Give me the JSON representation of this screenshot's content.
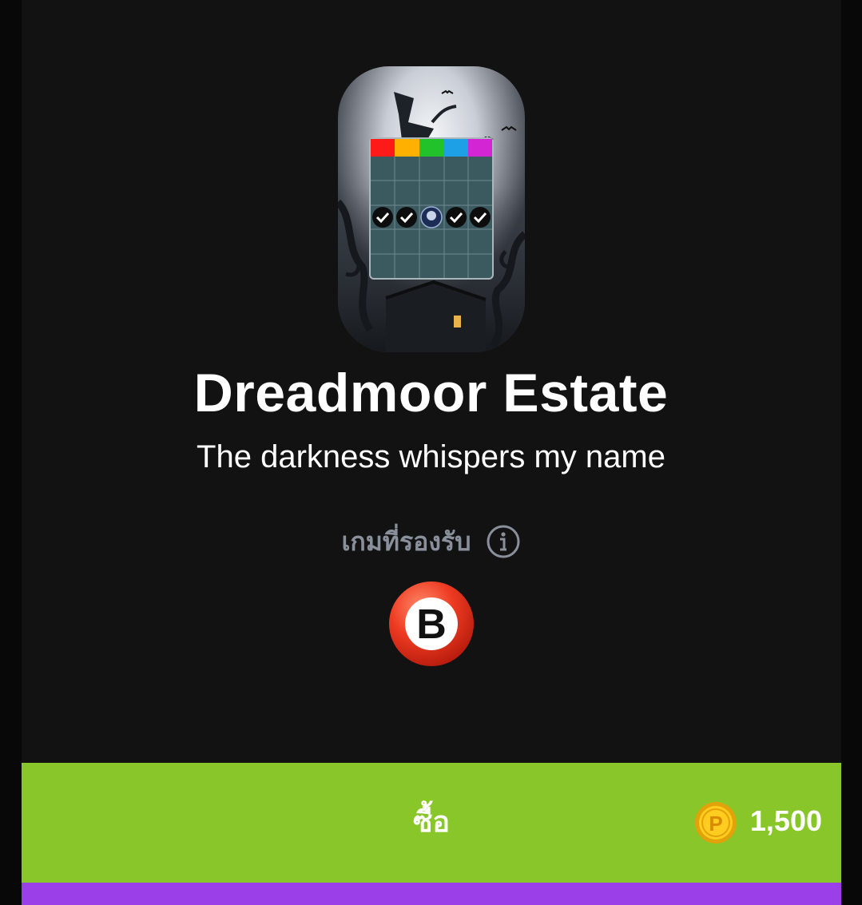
{
  "item": {
    "title": "Dreadmoor Estate",
    "subtitle": "The darkness whispers my name"
  },
  "supported_games": {
    "label": "เกมที่รองรับ",
    "info_icon": "info-icon",
    "games": [
      {
        "icon": "bingo-ball-icon",
        "letter": "B"
      }
    ]
  },
  "purchase": {
    "button_label": "ซื้อ",
    "currency_icon": "coin-icon",
    "currency_letter": "P",
    "price": "1,500"
  },
  "colors": {
    "buy_bar": "#88c62a",
    "next_bar": "#9b3fe8",
    "card_header": [
      "#ff1a1a",
      "#ffb000",
      "#22c22a",
      "#1ea0e6",
      "#d425d4"
    ]
  }
}
